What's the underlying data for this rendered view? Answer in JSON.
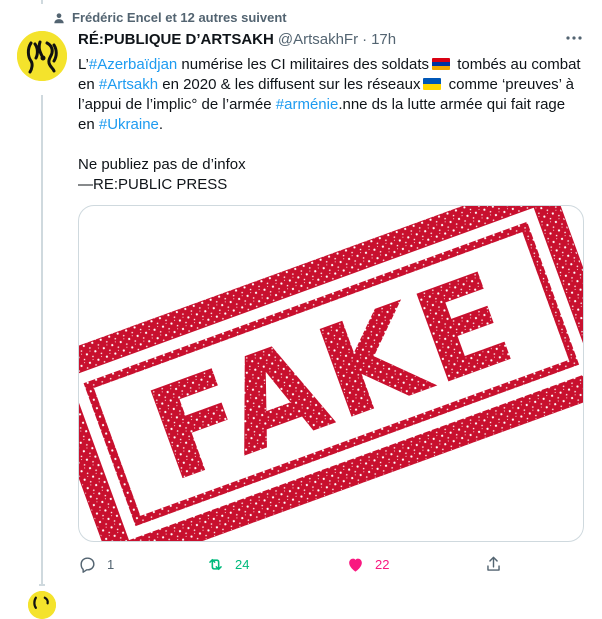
{
  "social_context": "Frédéric Encel et 12 autres suivent",
  "tweet": {
    "author_name": "RÉ:PUBLIQUE D’ARTSAKH",
    "handle": "@ArtsakhFr",
    "separator": "·",
    "time": "17h",
    "text": {
      "p1_a": "L’",
      "tag_azerbaidjan": "#Azerbaïdjan",
      "p1_b": " numérise les CI militaires des soldats",
      "p1_c": " tombés au combat en ",
      "tag_artsakh": "#Artsakh",
      "p1_d": " en 2020 & les diffusent sur les réseaux",
      "p1_e": " comme ‘preuves’ à l’appui de l’implic° de l’armée ",
      "tag_armenie": "#arménie",
      "p1_f": ".nne ds la lutte armée qui fait rage en ",
      "tag_ukraine": "#Ukraine",
      "p1_g": ".",
      "p2": "Ne publiez pas de d’infox",
      "p3": "—RE:PUBLIC PRESS"
    },
    "media_stamp_text": "FAKE",
    "actions": {
      "replies": "1",
      "retweets": "24",
      "likes": "22"
    }
  },
  "colors": {
    "link": "#1d9bf0",
    "retweet": "#00ba7c",
    "like": "#f91880",
    "stamp": "#c8102e",
    "avatar_bg": "#f4e32c",
    "flag_armenia": [
      "#d90012",
      "#0033a0",
      "#f2a800"
    ],
    "flag_ukraine": [
      "#0057b7",
      "#ffd700"
    ]
  },
  "icons": [
    "follow-icon",
    "more-icon",
    "reply-icon",
    "retweet-icon",
    "like-icon",
    "share-icon"
  ]
}
